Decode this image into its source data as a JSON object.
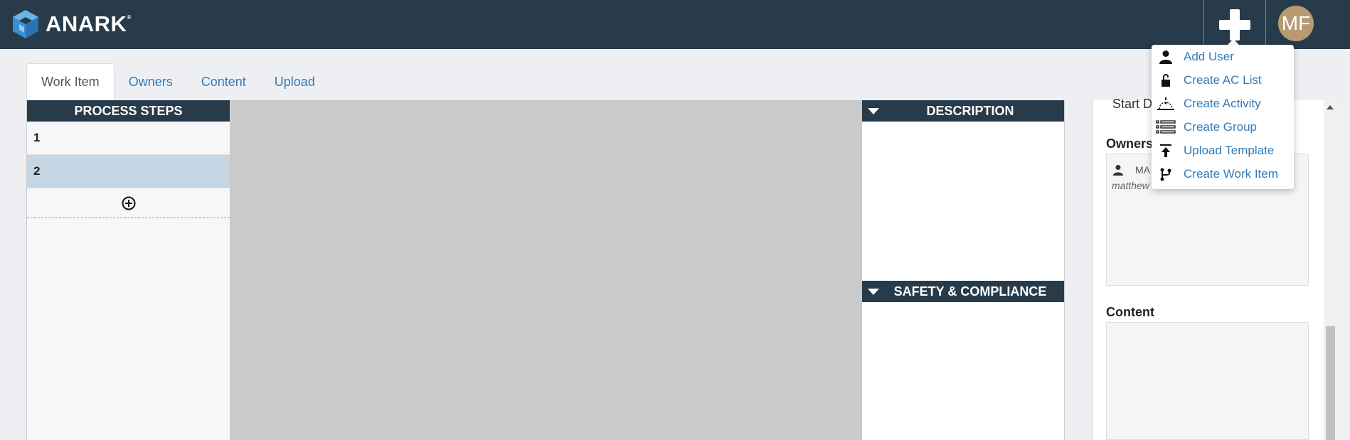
{
  "header": {
    "brand": "ANARK",
    "brand_mark": "®",
    "plus_icon": "plus-icon",
    "avatar_initials": "MF",
    "avatar_color": "#b89a72",
    "bar_color": "#273b4b"
  },
  "tabs": [
    {
      "label": "Work Item",
      "active": true
    },
    {
      "label": "Owners",
      "active": false
    },
    {
      "label": "Content",
      "active": false
    },
    {
      "label": "Upload",
      "active": false
    }
  ],
  "process_steps": {
    "title": "PROCESS STEPS",
    "steps": [
      {
        "label": "1",
        "selected": false
      },
      {
        "label": "2",
        "selected": true
      }
    ],
    "add_icon": "add-circle-icon"
  },
  "description": {
    "title": "DESCRIPTION"
  },
  "safety": {
    "title": "SAFETY & COMPLIANCE"
  },
  "right_panel": {
    "start_label": "Start D",
    "owners_label": "Owners",
    "owner_name": "MA",
    "owner_email": "matthew",
    "content_label": "Content"
  },
  "menu": {
    "items": [
      {
        "label": "Add User",
        "icon": "user-icon"
      },
      {
        "label": "Create AC List",
        "icon": "lock-icon"
      },
      {
        "label": "Create Activity",
        "icon": "activity-icon"
      },
      {
        "label": "Create Group",
        "icon": "group-list-icon"
      },
      {
        "label": "Upload Template",
        "icon": "upload-icon"
      },
      {
        "label": "Create Work Item",
        "icon": "branch-icon"
      }
    ]
  }
}
